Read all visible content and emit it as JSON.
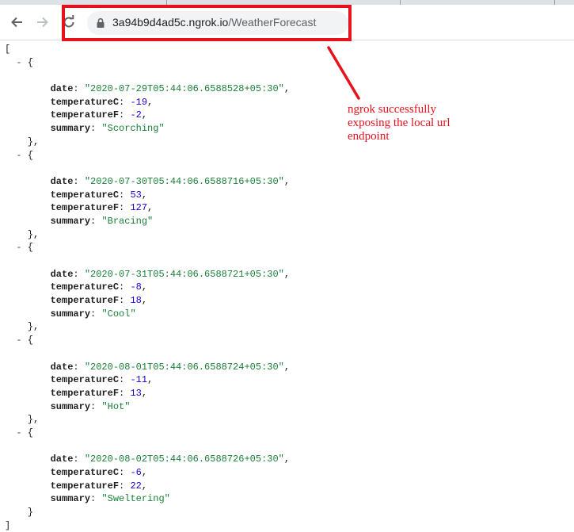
{
  "browser": {
    "url_host": "3a94b9d4ad5c.ngrok.io",
    "url_path": "/WeatherForecast",
    "back_icon": "arrow-left-icon",
    "forward_icon": "arrow-right-icon",
    "reload_icon": "reload-icon",
    "lock_icon": "lock-icon"
  },
  "annotation": {
    "lines": [
      "ngrok successfully",
      "exposing the local url",
      "endpoint"
    ],
    "color": "#e8121c"
  },
  "json": {
    "open_bracket": "[",
    "close_bracket": "]",
    "toggle": "-",
    "items": [
      {
        "date": "\"2020-07-29T05:44:06.6588528+05:30\"",
        "temperatureC": "-19",
        "temperatureF": "-2",
        "summary": "\"Scorching\""
      },
      {
        "date": "\"2020-07-30T05:44:06.6588716+05:30\"",
        "temperatureC": "53",
        "temperatureF": "127",
        "summary": "\"Bracing\""
      },
      {
        "date": "\"2020-07-31T05:44:06.6588721+05:30\"",
        "temperatureC": "-8",
        "temperatureF": "18",
        "summary": "\"Cool\""
      },
      {
        "date": "\"2020-08-01T05:44:06.6588724+05:30\"",
        "temperatureC": "-11",
        "temperatureF": "13",
        "summary": "\"Hot\""
      },
      {
        "date": "\"2020-08-02T05:44:06.6588726+05:30\"",
        "temperatureC": "-6",
        "temperatureF": "22",
        "summary": "\"Sweltering\""
      }
    ],
    "keys": {
      "date": "date",
      "temperatureC": "temperatureC",
      "temperatureF": "temperatureF",
      "summary": "summary"
    }
  }
}
